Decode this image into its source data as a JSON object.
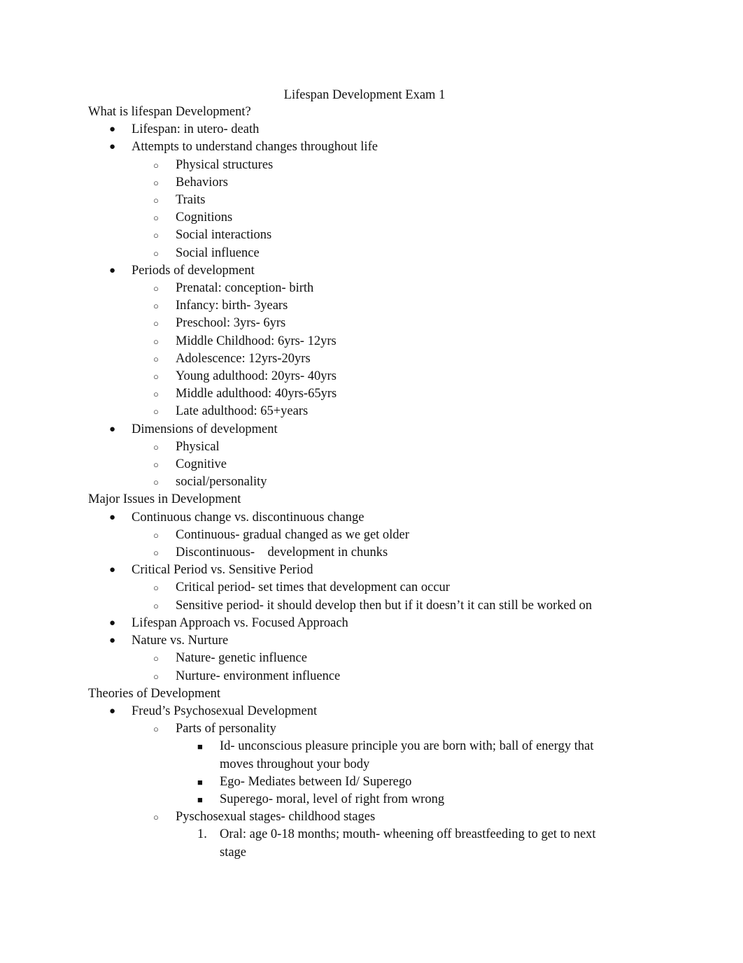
{
  "title": "Lifespan Development Exam 1",
  "lines": [
    {
      "level": 0,
      "text": "What is lifespan Development?"
    },
    {
      "level": 1,
      "marker": "●",
      "text": "Lifespan: in utero- death"
    },
    {
      "level": 1,
      "marker": "●",
      "text": "Attempts to understand changes throughout life"
    },
    {
      "level": 2,
      "marker": "○",
      "text": "Physical structures"
    },
    {
      "level": 2,
      "marker": "○",
      "text": "Behaviors"
    },
    {
      "level": 2,
      "marker": "○",
      "text": "Traits"
    },
    {
      "level": 2,
      "marker": "○",
      "text": "Cognitions"
    },
    {
      "level": 2,
      "marker": "○",
      "text": "Social interactions"
    },
    {
      "level": 2,
      "marker": "○",
      "text": "Social influence"
    },
    {
      "level": 1,
      "marker": "●",
      "text": "Periods of development"
    },
    {
      "level": 2,
      "marker": "○",
      "text": "Prenatal: conception- birth"
    },
    {
      "level": 2,
      "marker": "○",
      "text": "Infancy: birth- 3years"
    },
    {
      "level": 2,
      "marker": "○",
      "text": "Preschool: 3yrs- 6yrs"
    },
    {
      "level": 2,
      "marker": "○",
      "text": "Middle Childhood: 6yrs- 12yrs"
    },
    {
      "level": 2,
      "marker": "○",
      "text": "Adolescence: 12yrs-20yrs"
    },
    {
      "level": 2,
      "marker": "○",
      "text": "Young adulthood: 20yrs- 40yrs"
    },
    {
      "level": 2,
      "marker": "○",
      "text": "Middle adulthood: 40yrs-65yrs"
    },
    {
      "level": 2,
      "marker": "○",
      "text": "Late adulthood: 65+years"
    },
    {
      "level": 1,
      "marker": "●",
      "text": "Dimensions of development"
    },
    {
      "level": 2,
      "marker": "○",
      "text": "Physical"
    },
    {
      "level": 2,
      "marker": "○",
      "text": "Cognitive"
    },
    {
      "level": 2,
      "marker": "○",
      "text": "social/personality"
    },
    {
      "level": 0,
      "text": "Major Issues in Development"
    },
    {
      "level": 1,
      "marker": "●",
      "text": "Continuous change vs. discontinuous change"
    },
    {
      "level": 2,
      "marker": "○",
      "text": "Continuous- gradual changed as we get older"
    },
    {
      "level": 2,
      "marker": "○",
      "text": "Discontinuous-    development in chunks"
    },
    {
      "level": 1,
      "marker": "●",
      "text": "Critical Period vs. Sensitive Period"
    },
    {
      "level": 2,
      "marker": "○",
      "text": "Critical period- set times that development can occur"
    },
    {
      "level": 2,
      "marker": "○",
      "text": "Sensitive period- it should develop then but if it doesn’t it can still be worked on"
    },
    {
      "level": 1,
      "marker": "●",
      "text": "Lifespan Approach vs. Focused Approach"
    },
    {
      "level": 1,
      "marker": "●",
      "text": "Nature vs. Nurture"
    },
    {
      "level": 2,
      "marker": "○",
      "text": "Nature- genetic influence"
    },
    {
      "level": 2,
      "marker": "○",
      "text": "Nurture- environment influence"
    },
    {
      "level": 0,
      "text": "Theories of Development"
    },
    {
      "level": 1,
      "marker": "●",
      "text": "Freud’s Psychosexual Development"
    },
    {
      "level": 2,
      "marker": "○",
      "text": "Parts of personality"
    },
    {
      "level": 3,
      "marker": "■",
      "text": "Id- unconscious pleasure principle you are born with; ball of energy that moves throughout your body"
    },
    {
      "level": 3,
      "marker": "■",
      "text": "Ego- Mediates between Id/ Superego"
    },
    {
      "level": 3,
      "marker": "■",
      "text": "Superego- moral, level of right from wrong"
    },
    {
      "level": 2,
      "marker": "○",
      "text": "Pyschosexual stages- childhood stages"
    },
    {
      "level": 3,
      "marker": "1.",
      "numbered": true,
      "text": "Oral: age 0-18 months; mouth- wheening off breastfeeding to get to next stage"
    }
  ]
}
